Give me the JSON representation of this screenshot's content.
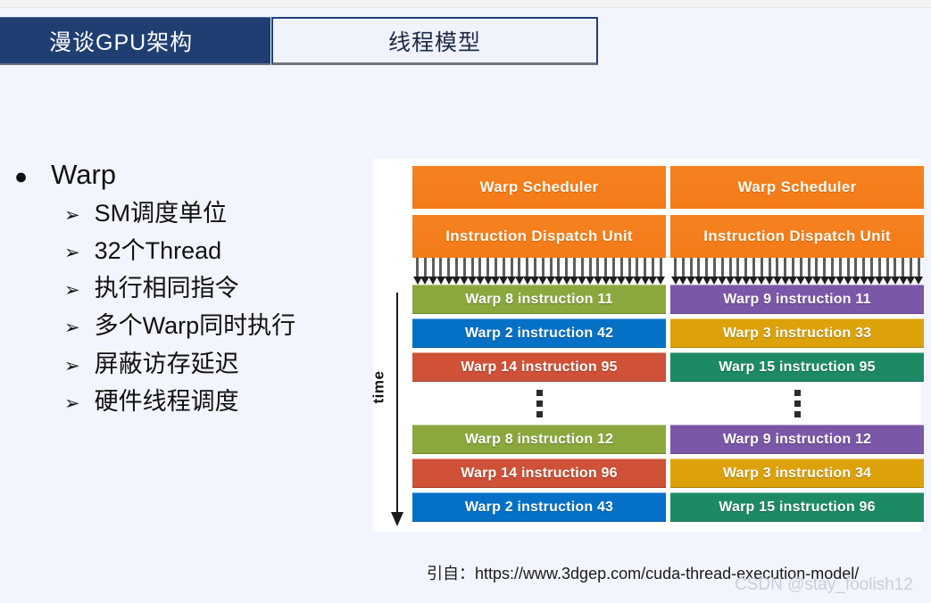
{
  "tabs": [
    {
      "label": "漫谈GPU架构",
      "active": true
    },
    {
      "label": "线程模型",
      "active": false
    }
  ],
  "bullets": {
    "main_marker": "●",
    "main_label": "Warp",
    "sub_marker": "➢",
    "sub_items": [
      "SM调度单位",
      "32个Thread",
      "执行相同指令",
      "多个Warp同时执行",
      "屏蔽访存延迟",
      "硬件线程调度"
    ]
  },
  "diagram": {
    "time_label": "time",
    "columns": [
      {
        "scheduler_label": "Warp Scheduler",
        "dispatch_label": "Instruction Dispatch Unit",
        "dispatch_arrow_count": 32,
        "rows_top": [
          {
            "label": "Warp 8 instruction 11",
            "color": "#8ba83e"
          },
          {
            "label": "Warp 2 instruction 42",
            "color": "#0571c6"
          },
          {
            "label": "Warp 14 instruction 95",
            "color": "#cf5137"
          }
        ],
        "rows_bottom": [
          {
            "label": "Warp 8 instruction 12",
            "color": "#8ba83e"
          },
          {
            "label": "Warp 14 instruction 96",
            "color": "#cf5137"
          },
          {
            "label": "Warp 2 instruction 43",
            "color": "#0571c6"
          }
        ]
      },
      {
        "scheduler_label": "Warp Scheduler",
        "dispatch_label": "Instruction Dispatch Unit",
        "dispatch_arrow_count": 32,
        "rows_top": [
          {
            "label": "Warp 9 instruction 11",
            "color": "#7b57a8"
          },
          {
            "label": "Warp 3 instruction 33",
            "color": "#dda20a"
          },
          {
            "label": "Warp 15 instruction 95",
            "color": "#1d8a66"
          }
        ],
        "rows_bottom": [
          {
            "label": "Warp 9 instruction 12",
            "color": "#7b57a8"
          },
          {
            "label": "Warp 3 instruction 34",
            "color": "#dda20a"
          },
          {
            "label": "Warp 15 instruction 96",
            "color": "#1d8a66"
          }
        ]
      }
    ]
  },
  "citation": "引自：https://www.3dgep.com/cuda-thread-execution-model/",
  "watermark": "CSDN @stay_foolish12",
  "colors": {
    "page_background": "#f2f5fd",
    "active_tab": "#1f3f73",
    "inactive_tab_border": "#22407a",
    "scheduler_orange": "#f47d20",
    "diagram_background": "#ffffff"
  }
}
